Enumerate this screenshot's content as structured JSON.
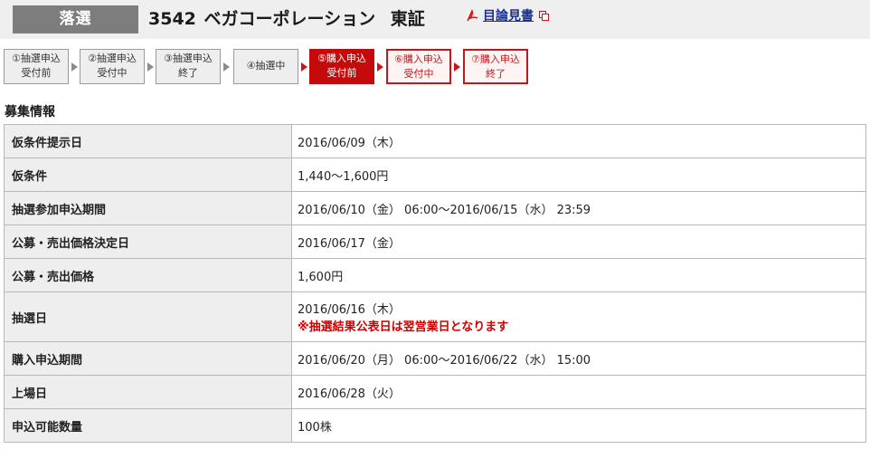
{
  "header": {
    "status": "落選",
    "code": "3542",
    "company": "ベガコーポレーション",
    "market": "東証",
    "prospectus_label": "目論見書"
  },
  "steps": [
    {
      "lines": [
        "①抽選申込",
        "受付前"
      ],
      "state": "done"
    },
    {
      "lines": [
        "②抽選申込",
        "受付中"
      ],
      "state": "done"
    },
    {
      "lines": [
        "③抽選申込",
        "終了"
      ],
      "state": "done"
    },
    {
      "lines": [
        "④抽選中"
      ],
      "state": "done"
    },
    {
      "lines": [
        "⑤購入申込",
        "受付前"
      ],
      "state": "active"
    },
    {
      "lines": [
        "⑥購入申込",
        "受付中"
      ],
      "state": "future"
    },
    {
      "lines": [
        "⑦購入申込",
        "終了"
      ],
      "state": "future"
    }
  ],
  "section_title": "募集情報",
  "rows": [
    {
      "label": "仮条件提示日",
      "value": "2016/06/09（木）"
    },
    {
      "label": "仮条件",
      "value": "1,440～1,600円"
    },
    {
      "label": "抽選参加申込期間",
      "value": "2016/06/10（金） 06:00～2016/06/15（水） 23:59"
    },
    {
      "label": "公募・売出価格決定日",
      "value": "2016/06/17（金）"
    },
    {
      "label": "公募・売出価格",
      "value": "1,600円"
    },
    {
      "label": "抽選日",
      "value": "2016/06/16（木）",
      "note": "※抽選結果公表日は翌営業日となります"
    },
    {
      "label": "購入申込期間",
      "value": "2016/06/20（月） 06:00～2016/06/22（水） 15:00"
    },
    {
      "label": "上場日",
      "value": "2016/06/28（火）"
    },
    {
      "label": "申込可能数量",
      "value": "100株"
    }
  ],
  "colors": {
    "status_bg": "#7d7d7d",
    "active_step": "#c40a0a",
    "future_step_border": "#c8141a",
    "note_text": "#cc0000",
    "link": "#1a2f8a"
  },
  "icons": [
    "pdf-icon",
    "external-window-icon"
  ]
}
